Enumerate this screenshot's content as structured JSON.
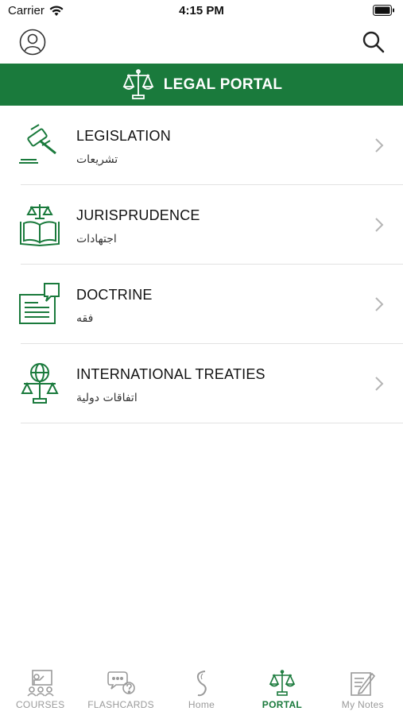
{
  "status_bar": {
    "carrier": "Carrier",
    "time": "4:15 PM"
  },
  "header": {
    "title": "LEGAL PORTAL"
  },
  "colors": {
    "brand_green": "#1a7a3c",
    "inactive_gray": "#9a9a9a"
  },
  "items": [
    {
      "title": "LEGISLATION",
      "subtitle": "تشريعات",
      "icon": "gavel-icon"
    },
    {
      "title": "JURISPRUDENCE",
      "subtitle": "اجتهادات",
      "icon": "scales-book-icon"
    },
    {
      "title": "DOCTRINE",
      "subtitle": "فقه",
      "icon": "document-speech-icon"
    },
    {
      "title": "INTERNATIONAL TREATIES",
      "subtitle": "اتفاقات دولية",
      "icon": "globe-scales-icon"
    }
  ],
  "tabs": [
    {
      "label": "COURSES",
      "icon": "courses-icon",
      "active": false
    },
    {
      "label": "FLASHCARDS",
      "icon": "flashcards-icon",
      "active": false
    },
    {
      "label": "Home",
      "icon": "home-s-icon",
      "active": false
    },
    {
      "label": "PORTAL",
      "icon": "scales-icon",
      "active": true
    },
    {
      "label": "My Notes",
      "icon": "notes-icon",
      "active": false
    }
  ]
}
